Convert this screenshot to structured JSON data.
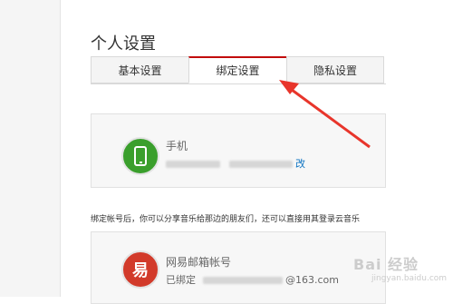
{
  "page": {
    "title": "个人设置"
  },
  "tabs": [
    {
      "label": "基本设置",
      "active": false
    },
    {
      "label": "绑定设置",
      "active": true
    },
    {
      "label": "隐私设置",
      "active": false
    }
  ],
  "phone_binding": {
    "title": "手机",
    "modify_link": "改",
    "icon": "phone-icon"
  },
  "notice": "绑定帐号后，你可以分享音乐给那边的朋友们，还可以直接用其登录云音乐",
  "mail_binding": {
    "title": "网易邮箱帐号",
    "icon_glyph": "易",
    "bound_prefix": "已绑定",
    "email_suffix": "@163.com"
  },
  "watermark": {
    "text": "Bai 经验",
    "sub": "jingyan.baidu.com"
  },
  "colors": {
    "accent": "#c20c0c",
    "phone_green": "#3a9f2c",
    "mail_red": "#d23a2a",
    "link": "#0c73c2"
  }
}
